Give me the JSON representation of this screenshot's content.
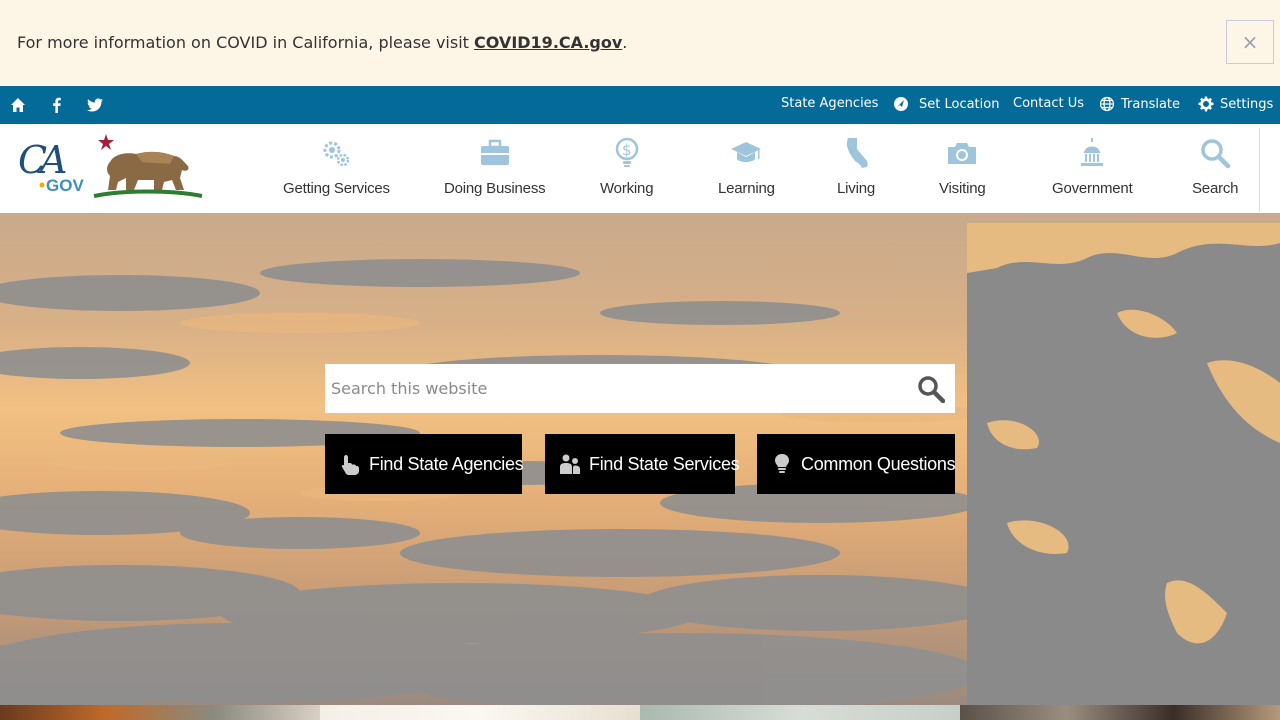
{
  "alert": {
    "text_before": "For more information on COVID in California, please visit ",
    "link_text": "COVID19.CA.gov",
    "text_after": ".",
    "close_label": "×"
  },
  "utility": {
    "social": [
      {
        "name": "home-icon"
      },
      {
        "name": "facebook-icon"
      },
      {
        "name": "twitter-icon"
      }
    ],
    "links": {
      "state_agencies": "State Agencies",
      "set_location": "Set Location",
      "contact_us": "Contact Us",
      "translate": "Translate",
      "settings": "Settings"
    }
  },
  "nav": {
    "items": [
      {
        "label": "Getting Services",
        "icon": "gears-icon"
      },
      {
        "label": "Doing Business",
        "icon": "briefcase-icon"
      },
      {
        "label": "Working",
        "icon": "dollar-bulb-icon"
      },
      {
        "label": "Learning",
        "icon": "graduation-cap-icon"
      },
      {
        "label": "Living",
        "icon": "california-icon"
      },
      {
        "label": "Visiting",
        "icon": "camera-icon"
      },
      {
        "label": "Government",
        "icon": "capitol-icon"
      },
      {
        "label": "Search",
        "icon": "search-icon"
      }
    ]
  },
  "hero": {
    "search_placeholder": "Search this website",
    "quick_links": [
      {
        "label": "Find State Agencies",
        "icon": "pointer-hand-icon"
      },
      {
        "label": "Find State Services",
        "icon": "people-icon"
      },
      {
        "label": "Common Questions",
        "icon": "lightbulb-icon"
      }
    ]
  },
  "colors": {
    "alert_bg": "#fdf6e7",
    "utility_bg": "#046b99",
    "nav_icon": "#9fc5dd",
    "quick_bg": "#000000"
  }
}
